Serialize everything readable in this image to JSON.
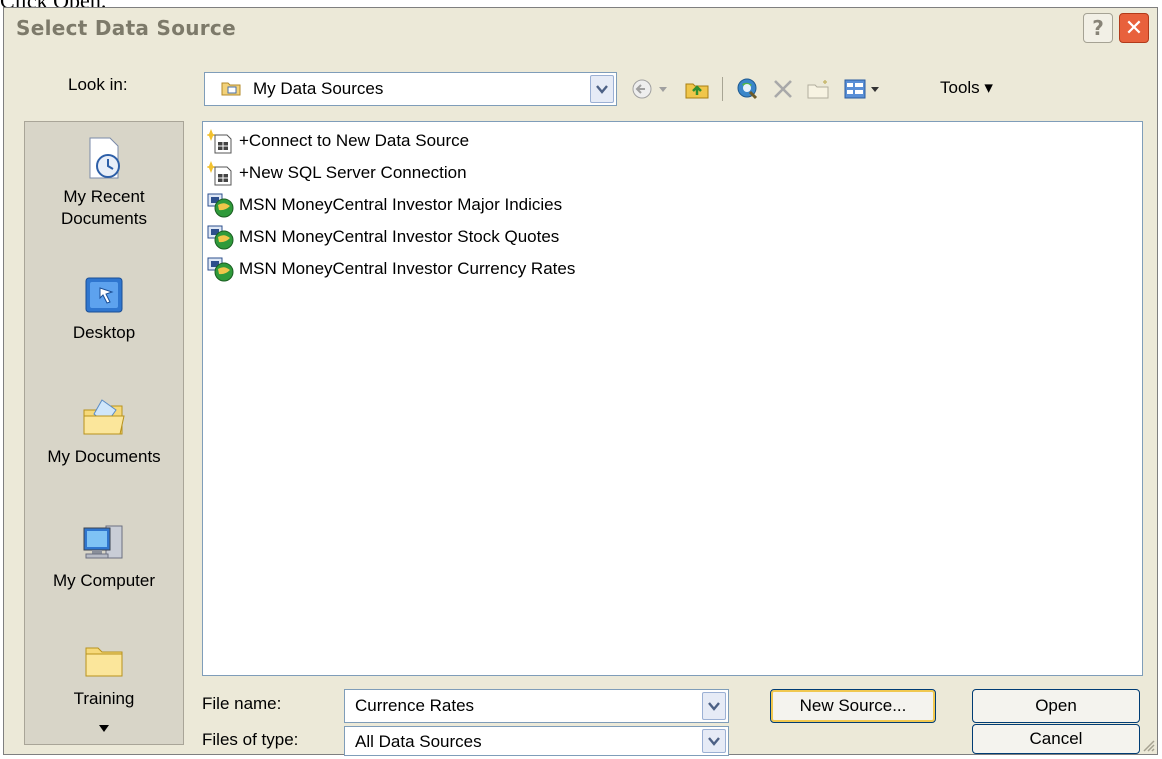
{
  "caption_above": "Click Open.",
  "dialog": {
    "title": "Select Data Source",
    "help_label": "?",
    "close_label": "✕"
  },
  "lookin": {
    "label": "Look in:",
    "value": "My Data Sources"
  },
  "toolbar": {
    "icons": [
      "back-icon",
      "up-folder-icon",
      "search-web-icon",
      "delete-icon",
      "new-folder-icon",
      "views-icon"
    ],
    "tools_label": "Tools ▾"
  },
  "places": [
    {
      "label": "My Recent Documents",
      "icon": "recent-documents-icon"
    },
    {
      "label": "Desktop",
      "icon": "desktop-icon"
    },
    {
      "label": "My Documents",
      "icon": "my-documents-icon"
    },
    {
      "label": "My Computer",
      "icon": "my-computer-icon"
    },
    {
      "label": "Training",
      "icon": "folder-icon"
    }
  ],
  "files": [
    {
      "name": "+Connect to New Data Source",
      "icon": "new-connection-icon"
    },
    {
      "name": "+New SQL Server Connection",
      "icon": "new-connection-icon"
    },
    {
      "name": "MSN MoneyCentral Investor Major Indicies",
      "icon": "web-query-icon"
    },
    {
      "name": "MSN MoneyCentral Investor Stock Quotes",
      "icon": "web-query-icon"
    },
    {
      "name": "MSN MoneyCentral Investor Currency Rates",
      "icon": "web-query-icon"
    }
  ],
  "filename": {
    "label": "File name:",
    "value": "Currence Rates"
  },
  "filetype": {
    "label": "Files of type:",
    "value": "All Data Sources"
  },
  "buttons": {
    "new_source": "New Source...",
    "open": "Open",
    "cancel": "Cancel"
  }
}
